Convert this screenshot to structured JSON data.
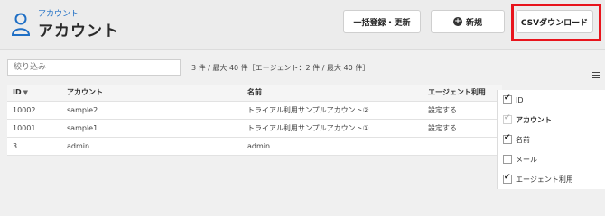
{
  "header": {
    "breadcrumb": "アカウント",
    "title": "アカウント",
    "buttons": {
      "bulk": "一括登録・更新",
      "new": "新規",
      "csv": "CSVダウンロード"
    }
  },
  "filter": {
    "placeholder": "絞り込み"
  },
  "count_text": "3 件 / 最大 40 件［エージェント：2 件 / 最大 40 件］",
  "table": {
    "headers": [
      "ID",
      "アカウント",
      "名前",
      "エージェント利用"
    ],
    "rows": [
      [
        "10002",
        "sample2",
        "トライアル利用サンプルアカウント②",
        "設定する"
      ],
      [
        "10001",
        "sample1",
        "トライアル利用サンプルアカウント①",
        "設定する"
      ],
      [
        "3",
        "admin",
        "admin",
        ""
      ]
    ]
  },
  "column_options": [
    {
      "label": "ID",
      "checked": true,
      "disabled": false
    },
    {
      "label": "アカウント",
      "checked": true,
      "disabled": true
    },
    {
      "label": "名前",
      "checked": true,
      "disabled": false
    },
    {
      "label": "メール",
      "checked": false,
      "disabled": false
    },
    {
      "label": "エージェント利用",
      "checked": true,
      "disabled": false
    }
  ],
  "colors": {
    "highlight": "#e8141c",
    "link": "#1f6fc5"
  }
}
